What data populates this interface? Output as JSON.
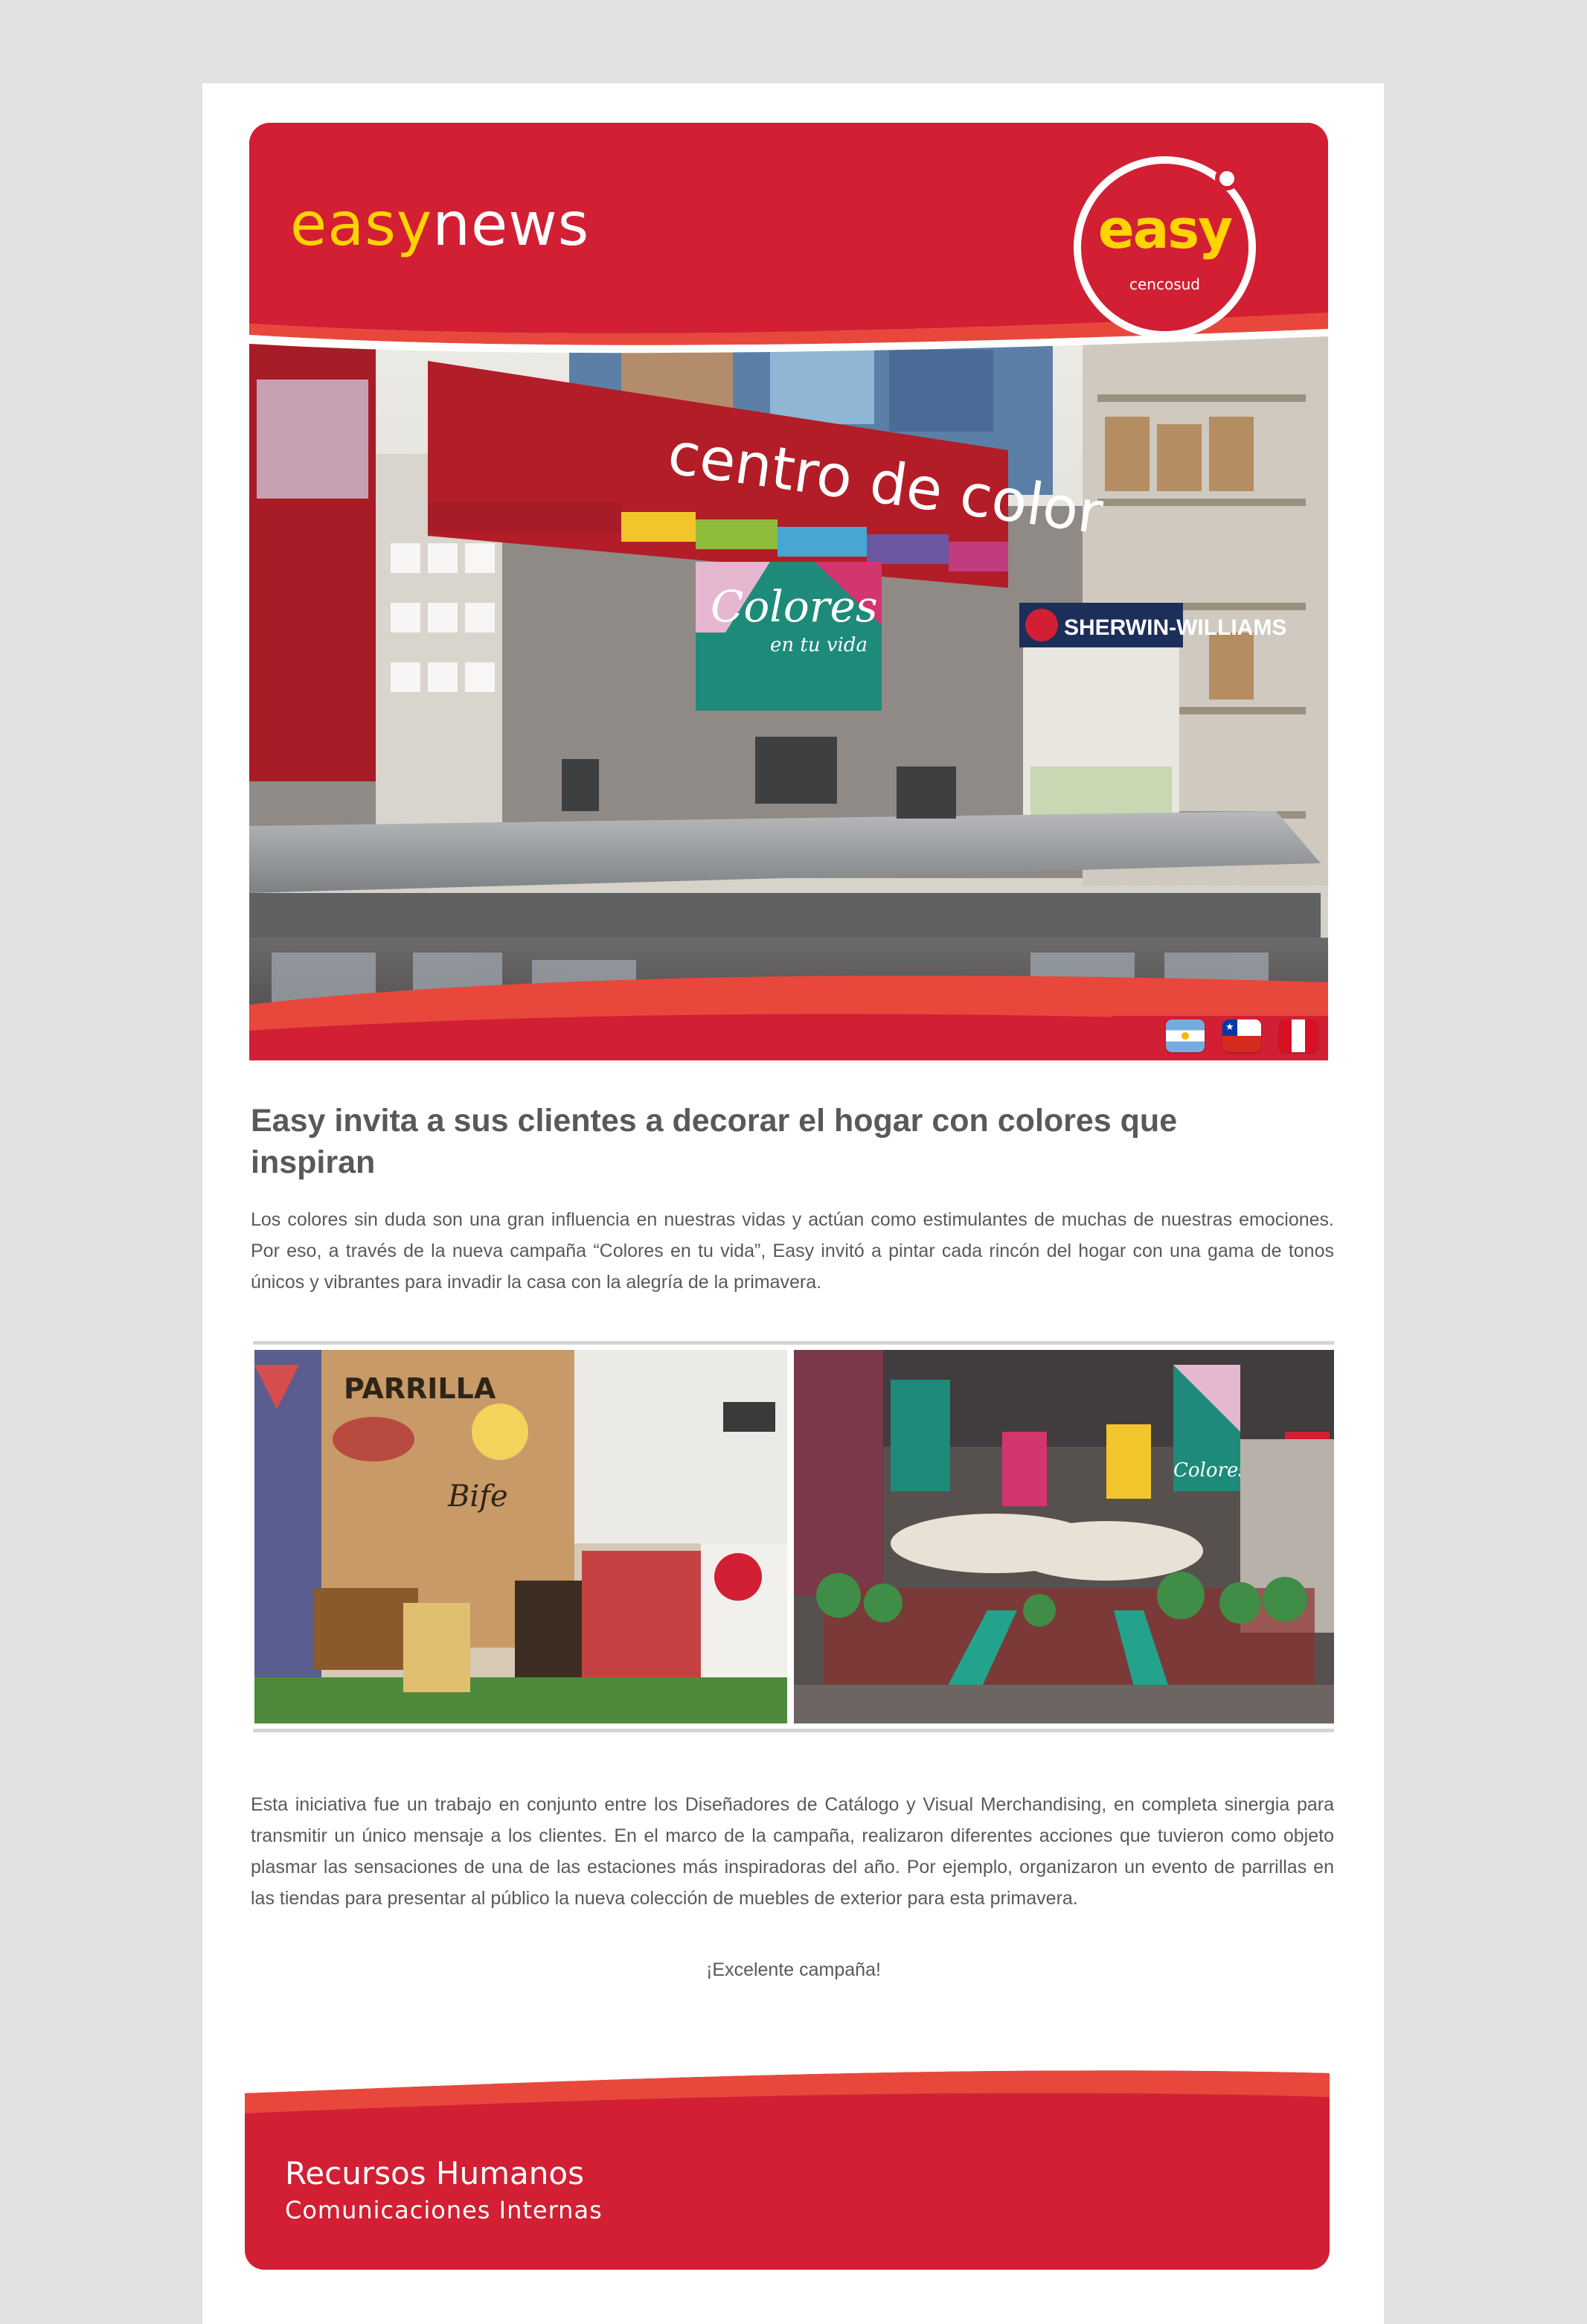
{
  "header": {
    "brand_part1": "easy",
    "brand_part2": "news",
    "logo_word": "easy",
    "logo_sub": "cencosud"
  },
  "hero": {
    "sign_text": "centro de color",
    "campaign_text": "Colores",
    "campaign_sub": "en tu vida",
    "shop_brand": "SHERWIN-WILLIAMS"
  },
  "flags": [
    "argentina-flag",
    "chile-flag",
    "peru-flag"
  ],
  "article": {
    "headline": "Easy invita a sus clientes a decorar el hogar con colores que inspiran",
    "paragraph1": "Los colores sin duda son una gran influencia en nuestras vidas y actúan como estimulantes de muchas de nuestras emociones. Por eso, a través de la nueva campaña “Colores en tu vida”, Easy invitó a pintar cada rincón del hogar con una gama de tonos únicos y vibrantes para invadir la casa con la alegría de la primavera.",
    "paragraph2": "Esta iniciativa fue un trabajo en conjunto entre los Diseñadores de Catálogo y Visual Merchandising, en completa sinergia para transmitir un único mensaje a los clientes. En el marco de la campaña, realizaron diferentes acciones que tuvieron como objeto plasmar las sensaciones de una de las estaciones más inspiradoras del año. Por ejemplo, organizaron un evento de parrillas en las tiendas para presentar al público la nueva colección de muebles de exterior para esta primavera.",
    "closing": "¡Excelente campaña!"
  },
  "gallery": {
    "left_sign": "PARRILLA",
    "left_word": "Bife",
    "right_banner": "Colores"
  },
  "footer": {
    "title": "Recursos Humanos",
    "subtitle": "Comunicaciones Internas"
  },
  "colors": {
    "brand_red": "#d21f33",
    "accent_orange": "#e8473c",
    "brand_yellow": "#ffd400",
    "text_gray": "#58595b"
  }
}
